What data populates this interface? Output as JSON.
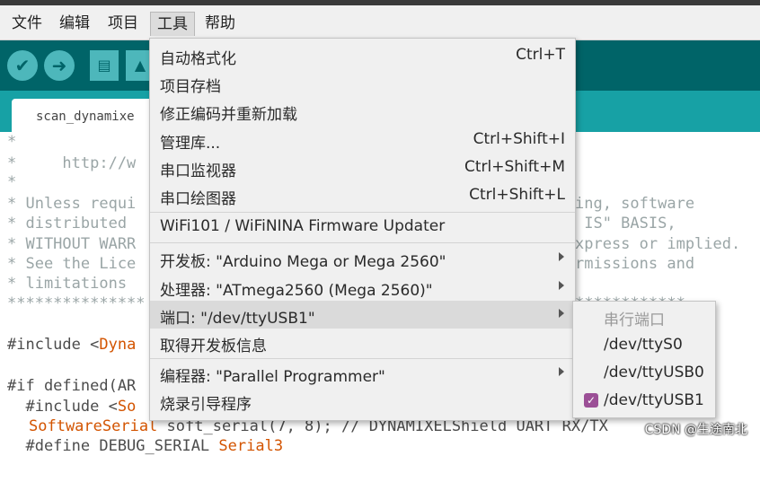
{
  "menubar": {
    "items": [
      "文件",
      "编辑",
      "项目",
      "工具",
      "帮助"
    ]
  },
  "tab": {
    "label": "scan_dynamixe"
  },
  "editor": {
    "lines": [
      "*",
      "*     http://w",
      "*",
      "* Unless requi",
      "* distributed ",
      "* WITHOUT WARR",
      "* See the Lice",
      "* limitations ",
      "***************",
      "",
      "#include <",
      "",
      "#if defined(AR",
      "  #include <"
    ],
    "include_kw": "Dyna",
    "include2_kw": "So",
    "softserial_kw": "SoftwareSerial",
    "softserial_rest": " soft_serial(7, 8); // DYNAMIXELShield UART RX/TX",
    "define_line": "  #define DEBUG_SERIAL ",
    "define_kw": "Serial3",
    "right_fragments": [
      "ing, software",
      " IS\" BASIS,",
      "xpress or implied.",
      "rmissions and",
      "************"
    ]
  },
  "tools_menu": {
    "items": [
      {
        "label": "自动格式化",
        "shortcut": "Ctrl+T"
      },
      {
        "label": "项目存档",
        "shortcut": ""
      },
      {
        "label": "修正编码并重新加载",
        "shortcut": ""
      },
      {
        "label": "管理库...",
        "shortcut": "Ctrl+Shift+I"
      },
      {
        "label": "串口监视器",
        "shortcut": "Ctrl+Shift+M"
      },
      {
        "label": "串口绘图器",
        "shortcut": "Ctrl+Shift+L"
      },
      {
        "label": "WiFi101 / WiFiNINA Firmware Updater",
        "shortcut": ""
      },
      {
        "label": "开发板: \"Arduino Mega or Mega 2560\"",
        "shortcut": ""
      },
      {
        "label": "处理器: \"ATmega2560 (Mega 2560)\"",
        "shortcut": ""
      },
      {
        "label": "端口: \"/dev/ttyUSB1\"",
        "shortcut": ""
      },
      {
        "label": "取得开发板信息",
        "shortcut": ""
      },
      {
        "label": "编程器: \"Parallel Programmer\"",
        "shortcut": ""
      },
      {
        "label": "烧录引导程序",
        "shortcut": ""
      }
    ]
  },
  "port_submenu": {
    "header": "串行端口",
    "items": [
      "/dev/ttyS0",
      "/dev/ttyUSB0",
      "/dev/ttyUSB1"
    ],
    "selected": "/dev/ttyUSB1"
  },
  "watermark": "CSDN @生途南北",
  "colors": {
    "toolbar": "#006468",
    "tabbar": "#17a1a5",
    "keyword": "#d35400",
    "check": "#9b4f96"
  }
}
